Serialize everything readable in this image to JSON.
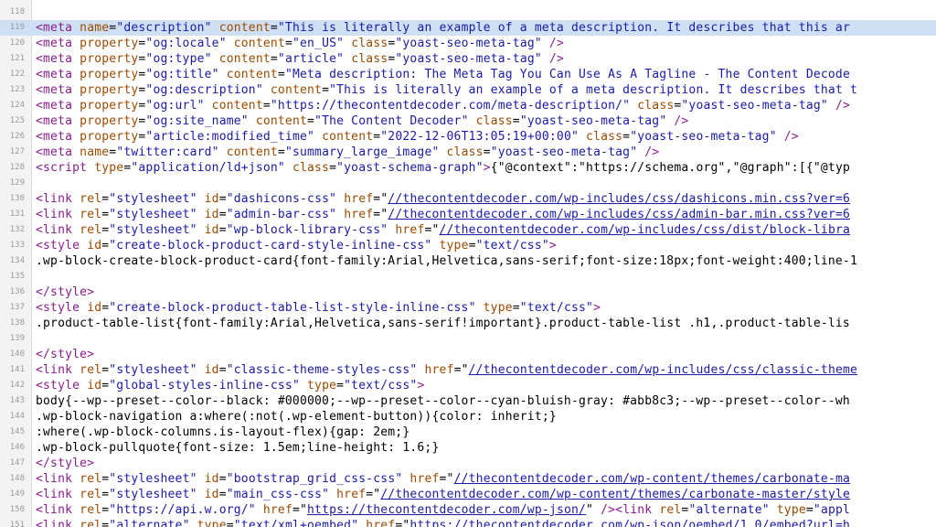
{
  "colors": {
    "tag": "#871e8c",
    "attribute": "#9c4a00",
    "string": "#1a1aa6",
    "text": "#000000",
    "highlight": "#cfe0f5",
    "gutter": "#f3f3f3"
  },
  "highlighted_line": 119,
  "lines": [
    {
      "n": "118",
      "tokens": []
    },
    {
      "n": "119",
      "tokens": [
        {
          "t": "tag",
          "v": "<meta "
        },
        {
          "t": "attr",
          "v": "name"
        },
        {
          "t": "txt",
          "v": "="
        },
        {
          "t": "str",
          "v": "\"description\" "
        },
        {
          "t": "attr",
          "v": "content"
        },
        {
          "t": "txt",
          "v": "="
        },
        {
          "t": "str",
          "v": "\"This is literally an example of a meta description. It describes that this ar"
        }
      ]
    },
    {
      "n": "120",
      "tokens": [
        {
          "t": "tag",
          "v": "<meta "
        },
        {
          "t": "attr",
          "v": "property"
        },
        {
          "t": "txt",
          "v": "="
        },
        {
          "t": "str",
          "v": "\"og:locale\" "
        },
        {
          "t": "attr",
          "v": "content"
        },
        {
          "t": "txt",
          "v": "="
        },
        {
          "t": "str",
          "v": "\"en_US\" "
        },
        {
          "t": "attr",
          "v": "class"
        },
        {
          "t": "txt",
          "v": "="
        },
        {
          "t": "str",
          "v": "\"yoast-seo-meta-tag\" "
        },
        {
          "t": "tag",
          "v": "/>"
        }
      ]
    },
    {
      "n": "121",
      "tokens": [
        {
          "t": "tag",
          "v": "<meta "
        },
        {
          "t": "attr",
          "v": "property"
        },
        {
          "t": "txt",
          "v": "="
        },
        {
          "t": "str",
          "v": "\"og:type\" "
        },
        {
          "t": "attr",
          "v": "content"
        },
        {
          "t": "txt",
          "v": "="
        },
        {
          "t": "str",
          "v": "\"article\" "
        },
        {
          "t": "attr",
          "v": "class"
        },
        {
          "t": "txt",
          "v": "="
        },
        {
          "t": "str",
          "v": "\"yoast-seo-meta-tag\" "
        },
        {
          "t": "tag",
          "v": "/>"
        }
      ]
    },
    {
      "n": "122",
      "tokens": [
        {
          "t": "tag",
          "v": "<meta "
        },
        {
          "t": "attr",
          "v": "property"
        },
        {
          "t": "txt",
          "v": "="
        },
        {
          "t": "str",
          "v": "\"og:title\" "
        },
        {
          "t": "attr",
          "v": "content"
        },
        {
          "t": "txt",
          "v": "="
        },
        {
          "t": "str",
          "v": "\"Meta description: The Meta Tag You Can Use As A Tagline - The Content Decode"
        }
      ]
    },
    {
      "n": "123",
      "tokens": [
        {
          "t": "tag",
          "v": "<meta "
        },
        {
          "t": "attr",
          "v": "property"
        },
        {
          "t": "txt",
          "v": "="
        },
        {
          "t": "str",
          "v": "\"og:description\" "
        },
        {
          "t": "attr",
          "v": "content"
        },
        {
          "t": "txt",
          "v": "="
        },
        {
          "t": "str",
          "v": "\"This is literally an example of a meta description. It describes that t"
        }
      ]
    },
    {
      "n": "124",
      "tokens": [
        {
          "t": "tag",
          "v": "<meta "
        },
        {
          "t": "attr",
          "v": "property"
        },
        {
          "t": "txt",
          "v": "="
        },
        {
          "t": "str",
          "v": "\"og:url\" "
        },
        {
          "t": "attr",
          "v": "content"
        },
        {
          "t": "txt",
          "v": "="
        },
        {
          "t": "str",
          "v": "\"https://thecontentdecoder.com/meta-description/\" "
        },
        {
          "t": "attr",
          "v": "class"
        },
        {
          "t": "txt",
          "v": "="
        },
        {
          "t": "str",
          "v": "\"yoast-seo-meta-tag\" "
        },
        {
          "t": "tag",
          "v": "/>"
        }
      ]
    },
    {
      "n": "125",
      "tokens": [
        {
          "t": "tag",
          "v": "<meta "
        },
        {
          "t": "attr",
          "v": "property"
        },
        {
          "t": "txt",
          "v": "="
        },
        {
          "t": "str",
          "v": "\"og:site_name\" "
        },
        {
          "t": "attr",
          "v": "content"
        },
        {
          "t": "txt",
          "v": "="
        },
        {
          "t": "str",
          "v": "\"The Content Decoder\" "
        },
        {
          "t": "attr",
          "v": "class"
        },
        {
          "t": "txt",
          "v": "="
        },
        {
          "t": "str",
          "v": "\"yoast-seo-meta-tag\" "
        },
        {
          "t": "tag",
          "v": "/>"
        }
      ]
    },
    {
      "n": "126",
      "tokens": [
        {
          "t": "tag",
          "v": "<meta "
        },
        {
          "t": "attr",
          "v": "property"
        },
        {
          "t": "txt",
          "v": "="
        },
        {
          "t": "str",
          "v": "\"article:modified_time\" "
        },
        {
          "t": "attr",
          "v": "content"
        },
        {
          "t": "txt",
          "v": "="
        },
        {
          "t": "str",
          "v": "\"2022-12-06T13:05:19+00:00\" "
        },
        {
          "t": "attr",
          "v": "class"
        },
        {
          "t": "txt",
          "v": "="
        },
        {
          "t": "str",
          "v": "\"yoast-seo-meta-tag\" "
        },
        {
          "t": "tag",
          "v": "/>"
        }
      ]
    },
    {
      "n": "127",
      "tokens": [
        {
          "t": "tag",
          "v": "<meta "
        },
        {
          "t": "attr",
          "v": "name"
        },
        {
          "t": "txt",
          "v": "="
        },
        {
          "t": "str",
          "v": "\"twitter:card\" "
        },
        {
          "t": "attr",
          "v": "content"
        },
        {
          "t": "txt",
          "v": "="
        },
        {
          "t": "str",
          "v": "\"summary_large_image\" "
        },
        {
          "t": "attr",
          "v": "class"
        },
        {
          "t": "txt",
          "v": "="
        },
        {
          "t": "str",
          "v": "\"yoast-seo-meta-tag\" "
        },
        {
          "t": "tag",
          "v": "/>"
        }
      ]
    },
    {
      "n": "128",
      "tokens": [
        {
          "t": "tag",
          "v": "<script "
        },
        {
          "t": "attr",
          "v": "type"
        },
        {
          "t": "txt",
          "v": "="
        },
        {
          "t": "str",
          "v": "\"application/ld+json\" "
        },
        {
          "t": "attr",
          "v": "class"
        },
        {
          "t": "txt",
          "v": "="
        },
        {
          "t": "str",
          "v": "\"yoast-schema-graph\""
        },
        {
          "t": "tag",
          "v": ">"
        },
        {
          "t": "txt",
          "v": "{\"@context\":\"https://schema.org\",\"@graph\":[{\"@typ"
        }
      ]
    },
    {
      "n": "129",
      "tokens": []
    },
    {
      "n": "130",
      "tokens": [
        {
          "t": "tag",
          "v": "<link "
        },
        {
          "t": "attr",
          "v": "rel"
        },
        {
          "t": "txt",
          "v": "="
        },
        {
          "t": "str",
          "v": "\"stylesheet\" "
        },
        {
          "t": "attr",
          "v": "id"
        },
        {
          "t": "txt",
          "v": "="
        },
        {
          "t": "str",
          "v": "\"dashicons-css\" "
        },
        {
          "t": "attr",
          "v": "href"
        },
        {
          "t": "txt",
          "v": "=\""
        },
        {
          "t": "link",
          "v": "//thecontentdecoder.com/wp-includes/css/dashicons.min.css?ver=6"
        }
      ]
    },
    {
      "n": "131",
      "tokens": [
        {
          "t": "tag",
          "v": "<link "
        },
        {
          "t": "attr",
          "v": "rel"
        },
        {
          "t": "txt",
          "v": "="
        },
        {
          "t": "str",
          "v": "\"stylesheet\" "
        },
        {
          "t": "attr",
          "v": "id"
        },
        {
          "t": "txt",
          "v": "="
        },
        {
          "t": "str",
          "v": "\"admin-bar-css\" "
        },
        {
          "t": "attr",
          "v": "href"
        },
        {
          "t": "txt",
          "v": "=\""
        },
        {
          "t": "link",
          "v": "//thecontentdecoder.com/wp-includes/css/admin-bar.min.css?ver=6"
        }
      ]
    },
    {
      "n": "132",
      "tokens": [
        {
          "t": "tag",
          "v": "<link "
        },
        {
          "t": "attr",
          "v": "rel"
        },
        {
          "t": "txt",
          "v": "="
        },
        {
          "t": "str",
          "v": "\"stylesheet\" "
        },
        {
          "t": "attr",
          "v": "id"
        },
        {
          "t": "txt",
          "v": "="
        },
        {
          "t": "str",
          "v": "\"wp-block-library-css\" "
        },
        {
          "t": "attr",
          "v": "href"
        },
        {
          "t": "txt",
          "v": "=\""
        },
        {
          "t": "link",
          "v": "//thecontentdecoder.com/wp-includes/css/dist/block-libra"
        }
      ]
    },
    {
      "n": "133",
      "tokens": [
        {
          "t": "tag",
          "v": "<style "
        },
        {
          "t": "attr",
          "v": "id"
        },
        {
          "t": "txt",
          "v": "="
        },
        {
          "t": "str",
          "v": "\"create-block-product-card-style-inline-css\" "
        },
        {
          "t": "attr",
          "v": "type"
        },
        {
          "t": "txt",
          "v": "="
        },
        {
          "t": "str",
          "v": "\"text/css\""
        },
        {
          "t": "tag",
          "v": ">"
        }
      ]
    },
    {
      "n": "134",
      "tokens": [
        {
          "t": "txt",
          "v": ".wp-block-create-block-product-card{font-family:Arial,Helvetica,sans-serif;font-size:18px;font-weight:400;line-1"
        }
      ]
    },
    {
      "n": "135",
      "tokens": []
    },
    {
      "n": "136",
      "tokens": [
        {
          "t": "tag",
          "v": "</style>"
        }
      ]
    },
    {
      "n": "137",
      "tokens": [
        {
          "t": "tag",
          "v": "<style "
        },
        {
          "t": "attr",
          "v": "id"
        },
        {
          "t": "txt",
          "v": "="
        },
        {
          "t": "str",
          "v": "\"create-block-product-table-list-style-inline-css\" "
        },
        {
          "t": "attr",
          "v": "type"
        },
        {
          "t": "txt",
          "v": "="
        },
        {
          "t": "str",
          "v": "\"text/css\""
        },
        {
          "t": "tag",
          "v": ">"
        }
      ]
    },
    {
      "n": "138",
      "tokens": [
        {
          "t": "txt",
          "v": ".product-table-list{font-family:Arial,Helvetica,sans-serif!important}.product-table-list .h1,.product-table-lis"
        }
      ]
    },
    {
      "n": "139",
      "tokens": []
    },
    {
      "n": "140",
      "tokens": [
        {
          "t": "tag",
          "v": "</style>"
        }
      ]
    },
    {
      "n": "141",
      "tokens": [
        {
          "t": "tag",
          "v": "<link "
        },
        {
          "t": "attr",
          "v": "rel"
        },
        {
          "t": "txt",
          "v": "="
        },
        {
          "t": "str",
          "v": "\"stylesheet\" "
        },
        {
          "t": "attr",
          "v": "id"
        },
        {
          "t": "txt",
          "v": "="
        },
        {
          "t": "str",
          "v": "\"classic-theme-styles-css\" "
        },
        {
          "t": "attr",
          "v": "href"
        },
        {
          "t": "txt",
          "v": "=\""
        },
        {
          "t": "link",
          "v": "//thecontentdecoder.com/wp-includes/css/classic-theme"
        }
      ]
    },
    {
      "n": "142",
      "tokens": [
        {
          "t": "tag",
          "v": "<style "
        },
        {
          "t": "attr",
          "v": "id"
        },
        {
          "t": "txt",
          "v": "="
        },
        {
          "t": "str",
          "v": "\"global-styles-inline-css\" "
        },
        {
          "t": "attr",
          "v": "type"
        },
        {
          "t": "txt",
          "v": "="
        },
        {
          "t": "str",
          "v": "\"text/css\""
        },
        {
          "t": "tag",
          "v": ">"
        }
      ]
    },
    {
      "n": "143",
      "tokens": [
        {
          "t": "txt",
          "v": "body{--wp--preset--color--black: #000000;--wp--preset--color--cyan-bluish-gray: #abb8c3;--wp--preset--color--wh"
        }
      ]
    },
    {
      "n": "144",
      "tokens": [
        {
          "t": "txt",
          "v": ".wp-block-navigation a:where(:not(.wp-element-button)){color: inherit;}"
        }
      ]
    },
    {
      "n": "145",
      "tokens": [
        {
          "t": "txt",
          "v": ":where(.wp-block-columns.is-layout-flex){gap: 2em;}"
        }
      ]
    },
    {
      "n": "146",
      "tokens": [
        {
          "t": "txt",
          "v": ".wp-block-pullquote{font-size: 1.5em;line-height: 1.6;}"
        }
      ]
    },
    {
      "n": "147",
      "tokens": [
        {
          "t": "tag",
          "v": "</style>"
        }
      ]
    },
    {
      "n": "148",
      "tokens": [
        {
          "t": "tag",
          "v": "<link "
        },
        {
          "t": "attr",
          "v": "rel"
        },
        {
          "t": "txt",
          "v": "="
        },
        {
          "t": "str",
          "v": "\"stylesheet\" "
        },
        {
          "t": "attr",
          "v": "id"
        },
        {
          "t": "txt",
          "v": "="
        },
        {
          "t": "str",
          "v": "\"bootstrap_grid_css-css\" "
        },
        {
          "t": "attr",
          "v": "href"
        },
        {
          "t": "txt",
          "v": "=\""
        },
        {
          "t": "link",
          "v": "//thecontentdecoder.com/wp-content/themes/carbonate-ma"
        }
      ]
    },
    {
      "n": "149",
      "tokens": [
        {
          "t": "tag",
          "v": "<link "
        },
        {
          "t": "attr",
          "v": "rel"
        },
        {
          "t": "txt",
          "v": "="
        },
        {
          "t": "str",
          "v": "\"stylesheet\" "
        },
        {
          "t": "attr",
          "v": "id"
        },
        {
          "t": "txt",
          "v": "="
        },
        {
          "t": "str",
          "v": "\"main_css-css\" "
        },
        {
          "t": "attr",
          "v": "href"
        },
        {
          "t": "txt",
          "v": "=\""
        },
        {
          "t": "link",
          "v": "//thecontentdecoder.com/wp-content/themes/carbonate-master/style"
        }
      ]
    },
    {
      "n": "150",
      "tokens": [
        {
          "t": "tag",
          "v": "<link "
        },
        {
          "t": "attr",
          "v": "rel"
        },
        {
          "t": "txt",
          "v": "="
        },
        {
          "t": "str",
          "v": "\"https://api.w.org/\" "
        },
        {
          "t": "attr",
          "v": "href"
        },
        {
          "t": "txt",
          "v": "=\""
        },
        {
          "t": "link",
          "v": "https://thecontentdecoder.com/wp-json/"
        },
        {
          "t": "txt",
          "v": "\" "
        },
        {
          "t": "tag",
          "v": "/><link "
        },
        {
          "t": "attr",
          "v": "rel"
        },
        {
          "t": "txt",
          "v": "="
        },
        {
          "t": "str",
          "v": "\"alternate\" "
        },
        {
          "t": "attr",
          "v": "type"
        },
        {
          "t": "txt",
          "v": "="
        },
        {
          "t": "str",
          "v": "\"appl"
        }
      ]
    },
    {
      "n": "151",
      "tokens": [
        {
          "t": "tag",
          "v": "<link "
        },
        {
          "t": "attr",
          "v": "rel"
        },
        {
          "t": "txt",
          "v": "="
        },
        {
          "t": "str",
          "v": "\"alternate\" "
        },
        {
          "t": "attr",
          "v": "type"
        },
        {
          "t": "txt",
          "v": "="
        },
        {
          "t": "str",
          "v": "\"text/xml+oembed\" "
        },
        {
          "t": "attr",
          "v": "href"
        },
        {
          "t": "txt",
          "v": "=\""
        },
        {
          "t": "link",
          "v": "https://thecontentdecoder.com/wp-json/oembed/1.0/embed?url=h"
        }
      ]
    }
  ]
}
